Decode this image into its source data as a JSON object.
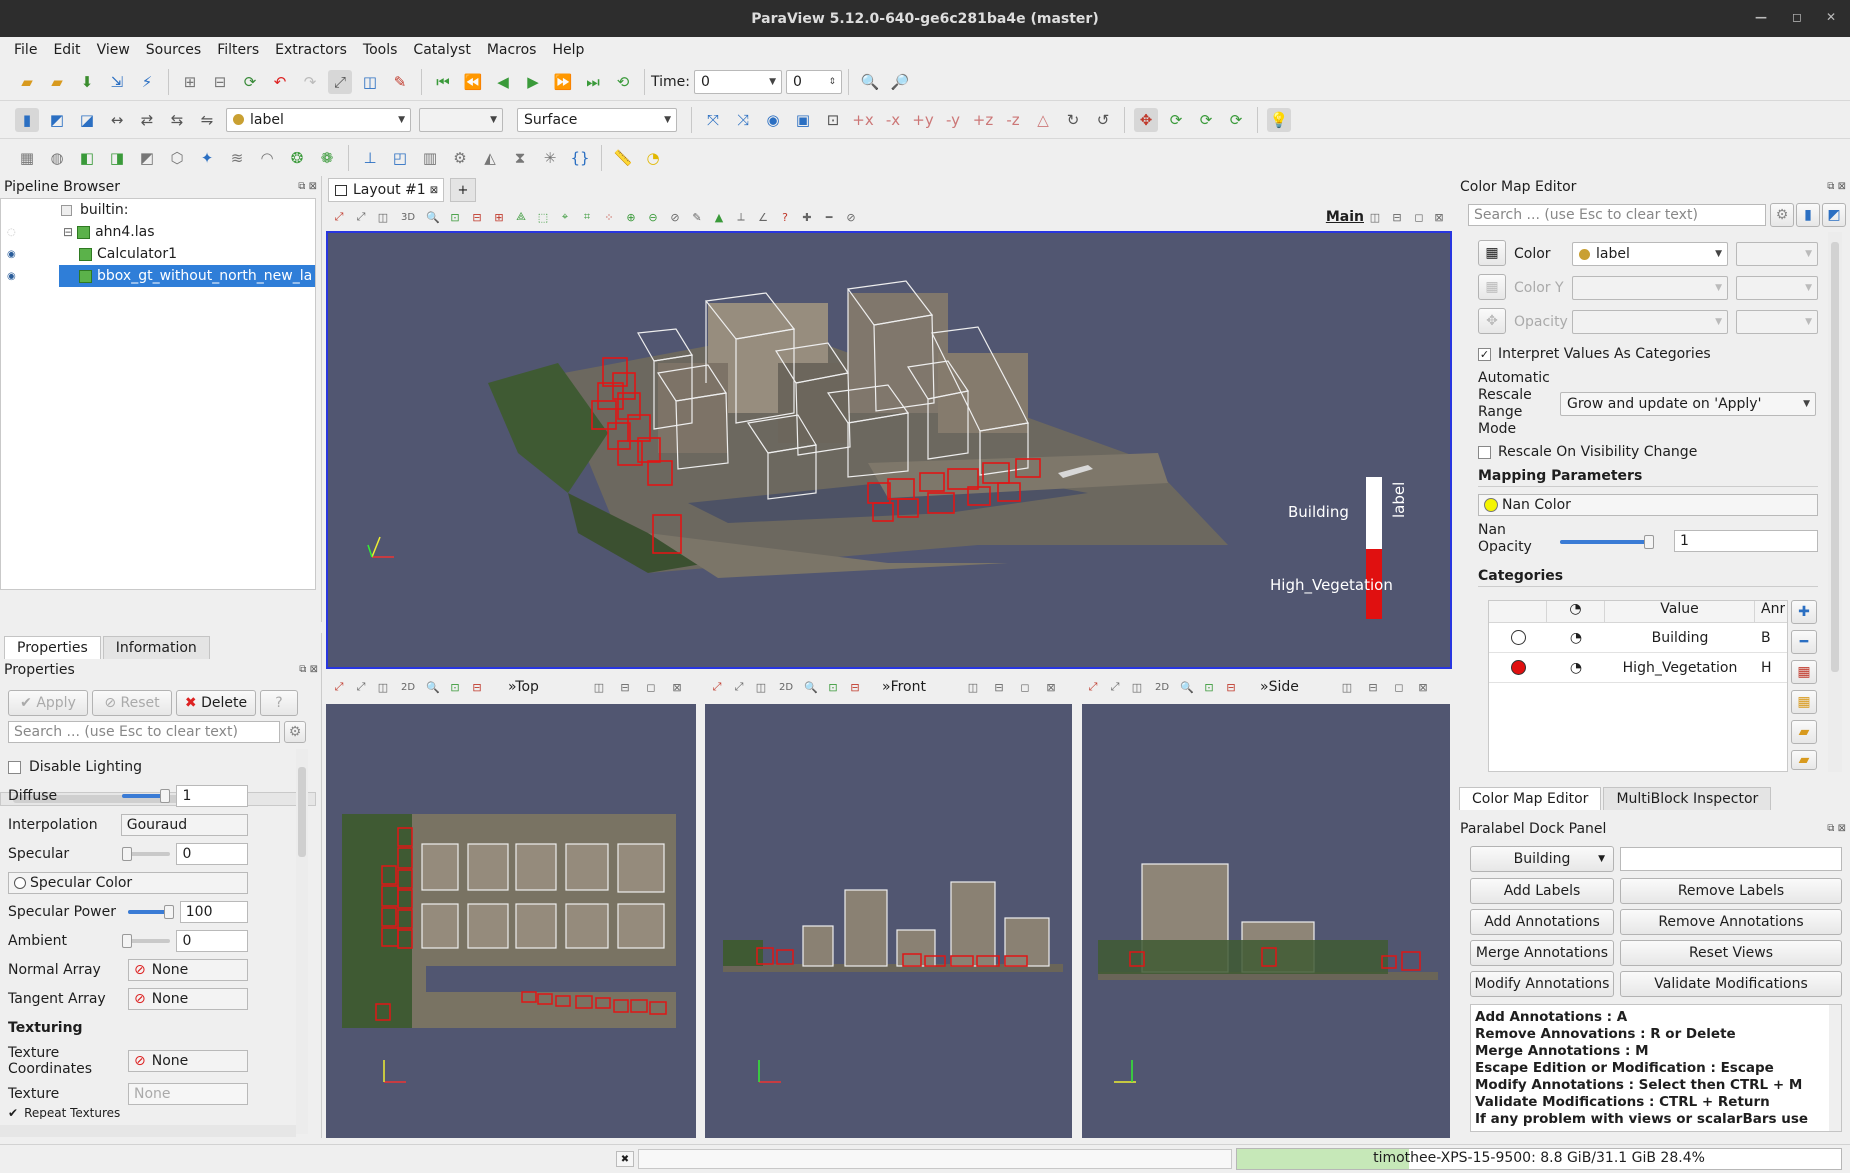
{
  "window": {
    "title": "ParaView 5.12.0-640-ge6c281ba4e (master)"
  },
  "menu": [
    "File",
    "Edit",
    "View",
    "Sources",
    "Filters",
    "Extractors",
    "Tools",
    "Catalyst",
    "Macros",
    "Help"
  ],
  "toolbar": {
    "time_label": "Time:",
    "time_value": "0",
    "timestep_value": "0",
    "color_array": "label",
    "representation": "Surface"
  },
  "pipeline": {
    "title": "Pipeline Browser",
    "root": "builtin:",
    "items": [
      "ahn4.las",
      "Calculator1",
      "bbox_gt_without_north_new_la"
    ]
  },
  "properties": {
    "tabs": [
      "Properties",
      "Information"
    ],
    "title": "Properties",
    "apply_label": "Apply",
    "reset_label": "Reset",
    "delete_label": "Delete",
    "help_label": "?",
    "search_placeholder": "Search ... (use Esc to clear text)",
    "disable_lighting": "Disable Lighting",
    "diffuse_label": "Diffuse",
    "diffuse_value": "1",
    "diffuse_level": 1,
    "interpolation_label": "Interpolation",
    "interpolation_value": "Gouraud",
    "specular_label": "Specular",
    "specular_value": "0",
    "specular_level": 0,
    "specular_color_label": "Specular Color",
    "specular_power_label": "Specular Power",
    "specular_power_value": "100",
    "specular_power_level": 1,
    "ambient_label": "Ambient",
    "ambient_value": "0",
    "ambient_level": 0,
    "normal_array_label": "Normal Array",
    "normal_array_value": "None",
    "tangent_array_label": "Tangent Array",
    "tangent_array_value": "None",
    "texturing_header": "Texturing",
    "texture_coords_label": "Texture Coordinates",
    "texture_coords_value": "None",
    "texture_label": "Texture",
    "texture_value": "None",
    "repeat_textures": "Repeat Textures"
  },
  "layout": {
    "tab_label": "Layout #1",
    "add_tab": "+"
  },
  "views": {
    "main_label": "Main",
    "main_mode": "3D",
    "top_label": "Top",
    "front_label": "Front",
    "side_label": "Side",
    "mode_2d": "2D",
    "legend_title": "label",
    "legend_building": "Building",
    "legend_vegetation": "High_Vegetation"
  },
  "colormap": {
    "title": "Color Map Editor",
    "search_placeholder": "Search ... (use Esc to clear text)",
    "color_label": "Color",
    "color_value": "label",
    "color_y_label": "Color Y",
    "opacity_label": "Opacity",
    "interpret_label": "Interpret Values As Categories",
    "auto_rescale_label": "Automatic Rescale Range Mode",
    "auto_rescale_value": "Grow and update on 'Apply'",
    "rescale_visibility": "Rescale On Visibility Change",
    "mapping_header": "Mapping Parameters",
    "nan_color_label": "Nan Color",
    "nan_opacity_label": "Nan Opacity",
    "nan_opacity_value": "1",
    "categories_header": "Categories",
    "col_value": "Value",
    "col_annotation": "Anr",
    "rows": [
      {
        "value": "Building",
        "annotation": "B",
        "color": "#ffffff"
      },
      {
        "value": "High_Vegetation",
        "annotation": "H",
        "color": "#e01010"
      }
    ],
    "bottom_tabs": [
      "Color Map Editor",
      "MultiBlock Inspector"
    ]
  },
  "paralabel": {
    "title": "Paralabel Dock Panel",
    "class_value": "Building",
    "buttons": [
      "Add Labels",
      "Remove Labels",
      "Add Annotations",
      "Remove Annotations",
      "Merge Annotations",
      "Reset Views",
      "Modify Annotations",
      "Validate Modifications"
    ],
    "help_lines": [
      "Add Annotations : A",
      "Remove Annovations : R or Delete",
      "Merge Annotations : M",
      "Escape Edition or Modification : Escape",
      "Modify Annotations : Select then CTRL + M",
      "Validate Modifications : CTRL + Return",
      "If any problem with views or scalarBars use"
    ]
  },
  "status": {
    "memory": "timothee-XPS-15-9500: 8.8 GiB/31.1 GiB 28.4%",
    "memory_fraction": 0.284
  }
}
